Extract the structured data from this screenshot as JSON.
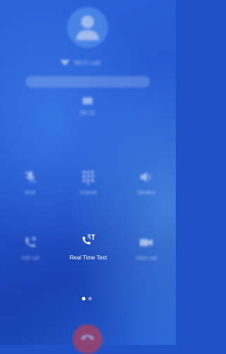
{
  "call": {
    "wifi_label": "Wi-Fi call",
    "timer": "00:11"
  },
  "controls": {
    "mute": "Mute",
    "keypad": "Keypad",
    "speaker": "Speaker",
    "add_call": "Add call",
    "rtt": "Real Time Text",
    "video": "Video call"
  },
  "colors": {
    "background": "#1f52c9",
    "avatar": "#5e9cf0",
    "end_call": "#e53935"
  },
  "pager": {
    "pages": 2,
    "active": 1
  }
}
